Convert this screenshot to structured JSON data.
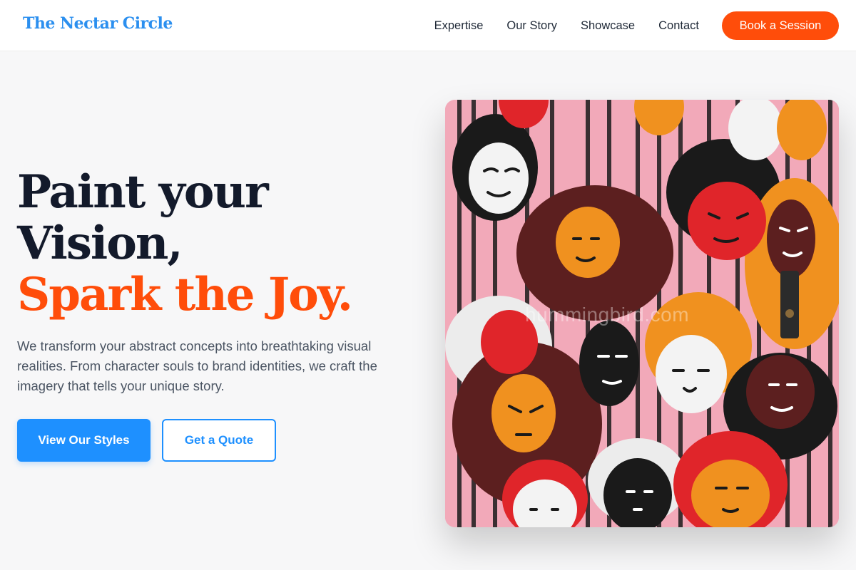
{
  "brand": {
    "name": "The Nectar Circle"
  },
  "nav": {
    "links": [
      "Expertise",
      "Our Story",
      "Showcase",
      "Contact"
    ],
    "cta": "Book a Session"
  },
  "hero": {
    "headline": {
      "line1": "Paint your",
      "line2": "Vision,",
      "line3": "Spark the Joy."
    },
    "description": "We transform your abstract concepts into breathtaking visual realities. From character souls to brand identities, we craft the imagery that tells your unique story.",
    "primary_button": "View Our Styles",
    "secondary_button": "Get a Quote",
    "image_watermark": "hummingbird.com"
  },
  "colors": {
    "brand_blue": "#1e90ff",
    "accent_orange": "#ff4d0a",
    "heading_dark": "#131a2b",
    "body_gray": "#4b5563",
    "page_background": "#f7f7f8"
  },
  "icons": []
}
